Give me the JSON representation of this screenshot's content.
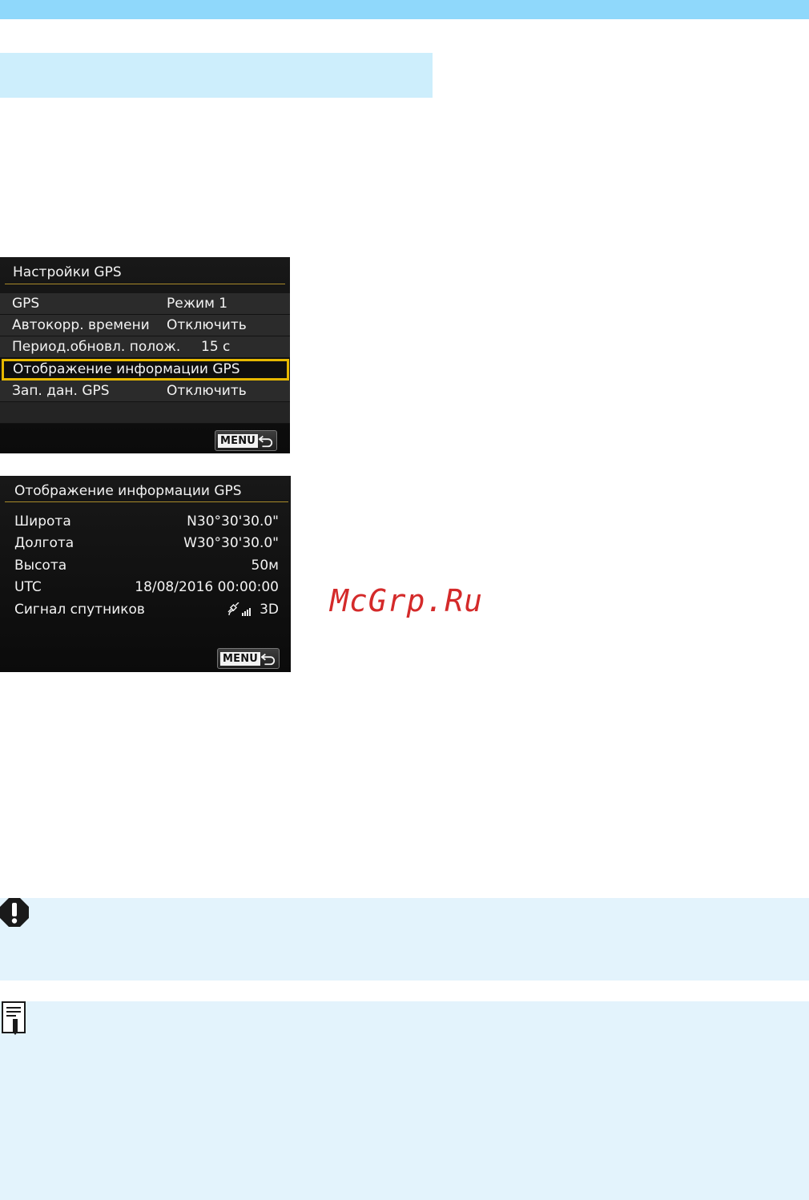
{
  "colors": {
    "top_bar": "#8fd8fb",
    "heading_band": "#cdeefc",
    "note_background": "#e3f3fc",
    "selection": "#e6b800",
    "watermark": "#d42a2a"
  },
  "gps_settings_screen": {
    "title": "Настройки GPS",
    "items": [
      {
        "label": "GPS",
        "value": "Режим 1"
      },
      {
        "label": "Автокорр. времени",
        "value": "Отключить"
      },
      {
        "label": "Период.обновл. полож.",
        "value": "15 с"
      },
      {
        "label": "Отображение информации GPS",
        "value": ""
      },
      {
        "label": "Зап. дан. GPS",
        "value": "Отключить"
      }
    ],
    "selected_index": 3,
    "menu_button_label": "MENU",
    "return_icon": "return-arrow-icon"
  },
  "gps_info_screen": {
    "title": "Отображение информации GPS",
    "rows": [
      {
        "label": "Широта",
        "value": "N30°30'30.0\""
      },
      {
        "label": "Долгота",
        "value": "W30°30'30.0\""
      },
      {
        "label": "Высота",
        "value": "50м"
      },
      {
        "label": "UTC",
        "value": "18/08/2016 00:00:00"
      },
      {
        "label": "Сигнал спутников",
        "value": "3D",
        "icon": "satellite-signal-icon"
      }
    ],
    "menu_button_label": "MENU",
    "return_icon": "return-arrow-icon"
  },
  "watermark": "McGrp.Ru",
  "caution_icon": "caution-icon",
  "note_icon": "note-icon"
}
